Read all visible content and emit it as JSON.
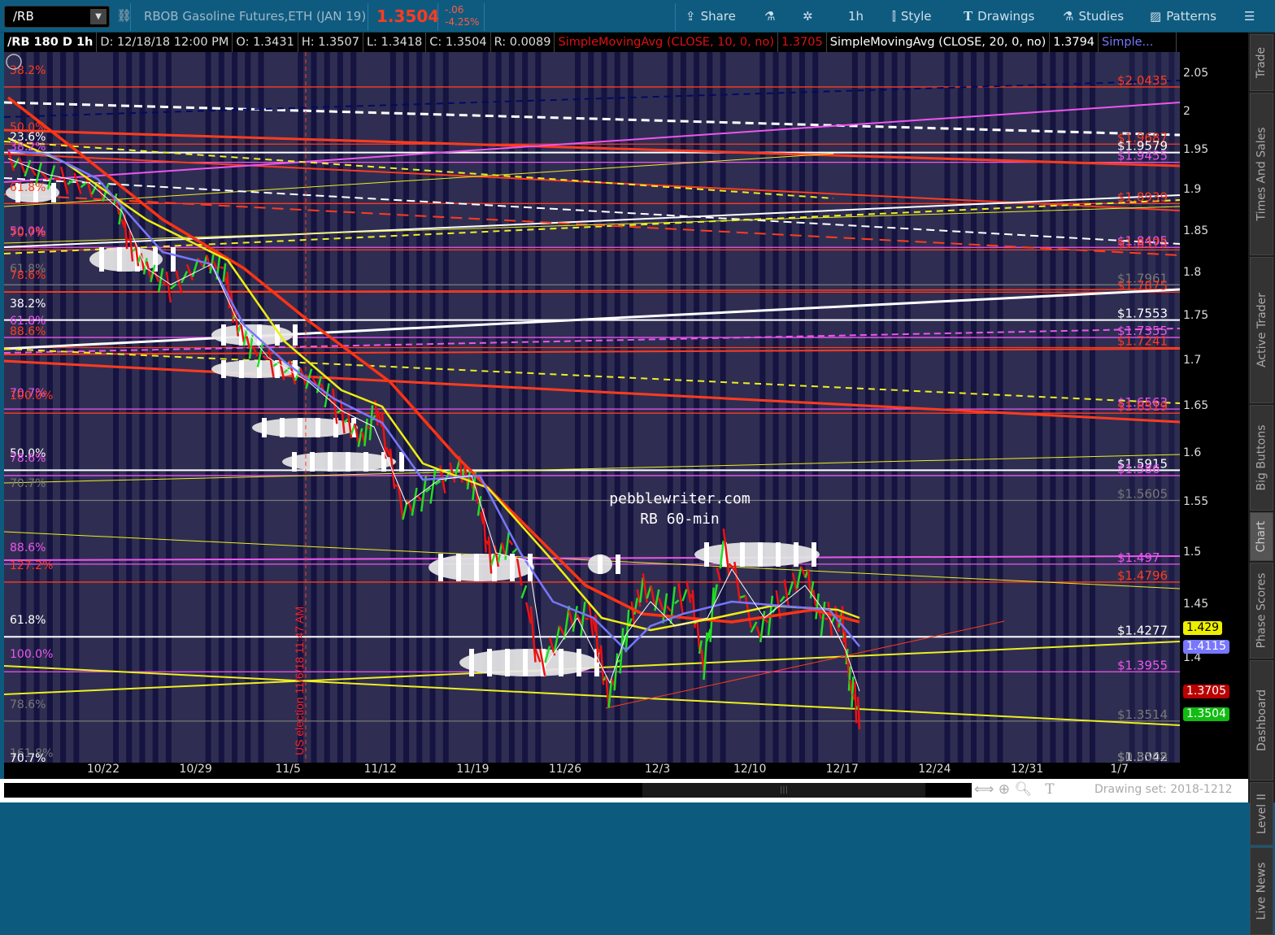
{
  "toolbar": {
    "symbol": "/RB",
    "description": "RBOB Gasoline Futures,ETH (JAN 19)",
    "last": "1.3504",
    "change": "-.06",
    "change_pct": "-4.25%",
    "share": "Share",
    "interval": "1h",
    "style": "Style",
    "drawings": "Drawings",
    "studies": "Studies",
    "patterns": "Patterns"
  },
  "infobar": {
    "title": "/RB 180 D 1h",
    "date": "D: 12/18/18 12:00 PM",
    "open": "O: 1.3431",
    "high": "H: 1.3507",
    "low": "L: 1.3418",
    "close": "C: 1.3504",
    "range": "R: 0.0089",
    "sma1": "SimpleMovingAvg (CLOSE, 10, 0, no)",
    "sma1_val": "1.3705",
    "sma2": "SimpleMovingAvg (CLOSE, 20, 0, no)",
    "sma2_val": "1.3794",
    "sma3": "Simple..."
  },
  "colors": {
    "bg": "#2f2e52",
    "stripe": "#15133f",
    "red": "#ff3b1f",
    "magenta": "#ee55ee",
    "white": "#ffffff",
    "gray": "#777777",
    "yellow": "#eeee22",
    "blue": "#7777ff",
    "green": "#22cc22"
  },
  "annotations": {
    "site": "pebblewriter.com",
    "subtitle": "RB  60-min",
    "election": "US election 11/6/18 11:47 AM"
  },
  "right_levels": [
    {
      "label": "$2.0435",
      "price": 2.0435,
      "color": "red"
    },
    {
      "label": "$1.9687",
      "price": 1.9687,
      "color": "red"
    },
    {
      "label": "$1.9579",
      "price": 1.9579,
      "color": "white"
    },
    {
      "label": "$1.9455",
      "price": 1.9455,
      "color": "magenta"
    },
    {
      "label": "$1.8939",
      "price": 1.8939,
      "color": "red"
    },
    {
      "label": "$1.8405",
      "price": 1.8405,
      "color": "magenta"
    },
    {
      "label": "$1.8375",
      "price": 1.8375,
      "color": "red"
    },
    {
      "label": "$1.7961",
      "price": 1.7961,
      "color": "gray"
    },
    {
      "label": "$1.7875",
      "price": 1.7875,
      "color": "red"
    },
    {
      "label": "$1.7553",
      "price": 1.7553,
      "color": "white"
    },
    {
      "label": "$1.7355",
      "price": 1.7355,
      "color": "magenta"
    },
    {
      "label": "$1.7241",
      "price": 1.7241,
      "color": "red"
    },
    {
      "label": "$1.6563",
      "price": 1.6563,
      "color": "magenta"
    },
    {
      "label": "$1.6519",
      "price": 1.6519,
      "color": "red"
    },
    {
      "label": "$1.5915",
      "price": 1.5915,
      "color": "white"
    },
    {
      "label": "$1.586",
      "price": 1.586,
      "color": "magenta"
    },
    {
      "label": "$1.5605",
      "price": 1.5605,
      "color": "gray"
    },
    {
      "label": "$1.497",
      "price": 1.497,
      "color": "magenta"
    },
    {
      "label": "$1.4796",
      "price": 1.4796,
      "color": "red"
    },
    {
      "label": "$1.4277",
      "price": 1.4277,
      "color": "white"
    },
    {
      "label": "$1.3955",
      "price": 1.3955,
      "color": "magenta"
    },
    {
      "label": "$1.3514",
      "price": 1.3514,
      "color": "gray"
    },
    {
      "label": "$1.3042",
      "price": 1.3042,
      "color": "white"
    },
    {
      "label": "$0.8508",
      "price": 0.8508,
      "color": "gray"
    }
  ],
  "left_labels": [
    {
      "text": "38.2%",
      "color": "red"
    },
    {
      "text": "50.0%",
      "color": "red"
    },
    {
      "text": "23.6%",
      "color": "white"
    },
    {
      "text": "38.2%",
      "color": "magenta"
    },
    {
      "text": "61.8%",
      "color": "red"
    },
    {
      "text": "50.0%",
      "color": "magenta"
    },
    {
      "text": "70.7%",
      "color": "red"
    },
    {
      "text": "61.8%",
      "color": "gray"
    },
    {
      "text": "78.6%",
      "color": "red"
    },
    {
      "text": "38.2%",
      "color": "white"
    },
    {
      "text": "61.8%",
      "color": "magenta"
    },
    {
      "text": "88.6%",
      "color": "red"
    },
    {
      "text": "70.7%",
      "color": "magenta"
    },
    {
      "text": "100.0%",
      "color": "red"
    },
    {
      "text": "50.0%",
      "color": "white"
    },
    {
      "text": "78.6%",
      "color": "magenta"
    },
    {
      "text": "70.7%",
      "color": "gray"
    },
    {
      "text": "88.6%",
      "color": "magenta"
    },
    {
      "text": "127.2%",
      "color": "red"
    },
    {
      "text": "61.8%",
      "color": "white"
    },
    {
      "text": "100.0%",
      "color": "magenta"
    },
    {
      "text": "78.6%",
      "color": "gray"
    },
    {
      "text": "161.8%",
      "color": "gray"
    },
    {
      "text": "70.7%",
      "color": "white"
    }
  ],
  "price_axis": {
    "ticks": [
      "2.05",
      "2",
      "1.95",
      "1.9",
      "1.85",
      "1.8",
      "1.75",
      "1.7",
      "1.65",
      "1.6",
      "1.55",
      "1.5",
      "1.45",
      "1.4"
    ],
    "tick_values": [
      2.05,
      2,
      1.95,
      1.9,
      1.85,
      1.8,
      1.75,
      1.7,
      1.65,
      1.6,
      1.55,
      1.5,
      1.45,
      1.4
    ]
  },
  "badges": [
    {
      "label": "1.429",
      "price": 1.429,
      "bg": "#eeee00",
      "fg": "#000"
    },
    {
      "label": "1.4115",
      "price": 1.4115,
      "bg": "#7777ff",
      "fg": "#fff"
    },
    {
      "label": "1.3705",
      "price": 1.3705,
      "bg": "#bb0000",
      "fg": "#fff"
    },
    {
      "label": "1.3504",
      "price": 1.3504,
      "bg": "#11bb11",
      "fg": "#fff"
    }
  ],
  "date_axis": [
    "10/22",
    "10/29",
    "11/5",
    "11/12",
    "11/19",
    "11/26",
    "12/3",
    "12/10",
    "12/17",
    "12/24",
    "12/31",
    "1/7"
  ],
  "price_series": [
    [
      -7.2,
      1.94
    ],
    [
      -4.7,
      1.919
    ],
    [
      -1.7,
      1.908
    ],
    [
      0.8,
      1.894
    ],
    [
      2,
      1.835
    ],
    [
      3.3,
      1.806
    ],
    [
      5.1,
      1.782
    ],
    [
      7.6,
      1.815
    ],
    [
      9.1,
      1.806
    ],
    [
      10,
      1.745
    ],
    [
      11.3,
      1.713
    ],
    [
      13.7,
      1.691
    ],
    [
      16.2,
      1.677
    ],
    [
      18,
      1.642
    ],
    [
      19.6,
      1.615
    ],
    [
      20.8,
      1.646
    ],
    [
      22.7,
      1.541
    ],
    [
      24.8,
      1.565
    ],
    [
      27,
      1.586
    ],
    [
      28.2,
      1.565
    ],
    [
      29.4,
      1.492
    ],
    [
      31,
      1.512
    ],
    [
      33.1,
      1.393
    ],
    [
      35.3,
      1.437
    ],
    [
      37.1,
      1.437
    ],
    [
      38.3,
      1.364
    ],
    [
      39.6,
      1.422
    ],
    [
      40.9,
      1.468
    ],
    [
      42.7,
      1.445
    ],
    [
      44.5,
      1.464
    ],
    [
      45.5,
      1.393
    ],
    [
      47,
      1.508
    ],
    [
      49.5,
      1.422
    ],
    [
      51.3,
      1.453
    ],
    [
      53.2,
      1.484
    ],
    [
      54.4,
      1.437
    ],
    [
      56,
      1.437
    ],
    [
      56.6,
      1.377
    ],
    [
      57.3,
      1.349
    ]
  ],
  "bottom": {
    "drawing_set": "Drawing set: 2018-1212"
  },
  "sidebar": [
    "Trade",
    "Times And Sales",
    "Active Trader",
    "Big Buttons",
    "Chart",
    "Phase Scores",
    "Dashboard",
    "Level II",
    "Live News"
  ]
}
